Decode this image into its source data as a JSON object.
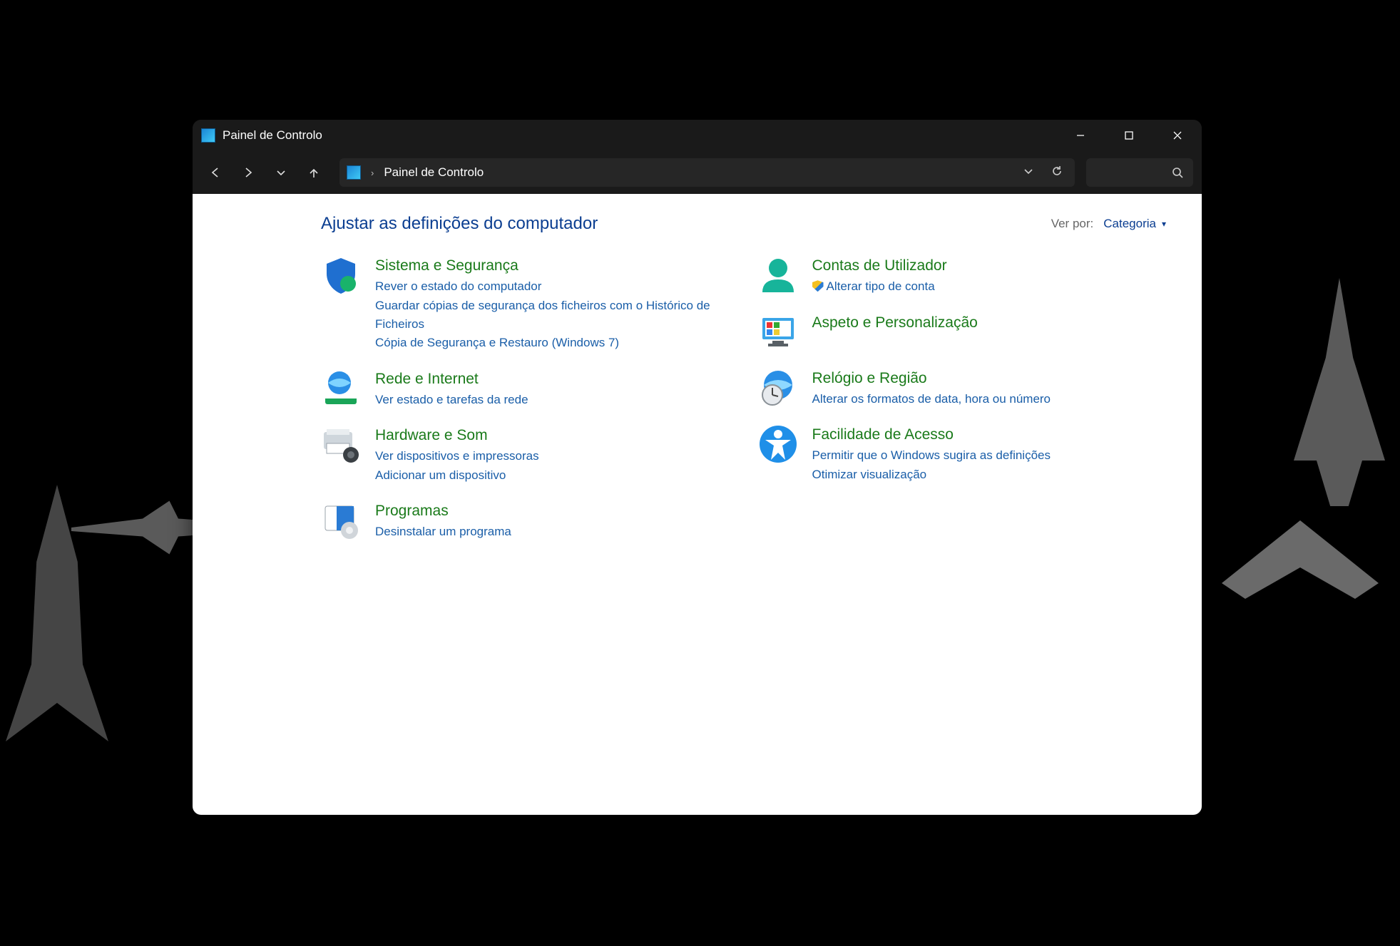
{
  "window": {
    "title": "Painel de Controlo",
    "breadcrumb": "Painel de Controlo"
  },
  "header": {
    "page_title": "Ajustar as definições do computador",
    "view_by_label": "Ver por:",
    "view_by_value": "Categoria"
  },
  "left": {
    "system": {
      "title": "Sistema e Segurança",
      "links": {
        "0": "Rever o estado do computador",
        "1": "Guardar cópias de segurança dos ficheiros com o Histórico de Ficheiros",
        "2": "Cópia de Segurança e Restauro (Windows 7)"
      }
    },
    "network": {
      "title": "Rede e Internet",
      "links": {
        "0": "Ver estado e tarefas da rede"
      }
    },
    "hardware": {
      "title": "Hardware e Som",
      "links": {
        "0": "Ver dispositivos e impressoras",
        "1": "Adicionar um dispositivo"
      }
    },
    "programs": {
      "title": "Programas",
      "links": {
        "0": "Desinstalar um programa"
      }
    }
  },
  "right": {
    "users": {
      "title": "Contas de Utilizador",
      "links": {
        "0": "Alterar tipo de conta"
      }
    },
    "appearance": {
      "title": "Aspeto e Personalização"
    },
    "clock": {
      "title": "Relógio e Região",
      "links": {
        "0": "Alterar os formatos de data, hora ou número"
      }
    },
    "ease": {
      "title": "Facilidade de Acesso",
      "links": {
        "0": "Permitir que o Windows sugira as definições",
        "1": "Otimizar visualização"
      }
    }
  }
}
